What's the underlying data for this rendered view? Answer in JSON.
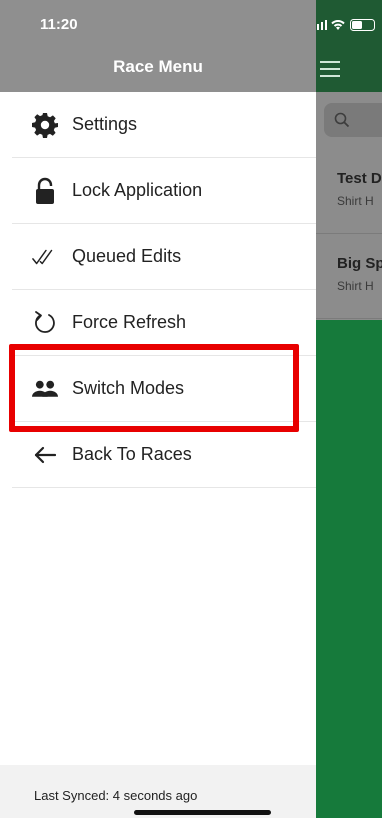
{
  "status": {
    "time": "11:20"
  },
  "drawer": {
    "title": "Race Menu",
    "items": [
      {
        "label": "Settings",
        "icon": "gear-icon"
      },
      {
        "label": "Lock Application",
        "icon": "lock-icon"
      },
      {
        "label": "Queued Edits",
        "icon": "double-check-icon"
      },
      {
        "label": "Force Refresh",
        "icon": "refresh-icon"
      },
      {
        "label": "Switch Modes",
        "icon": "users-icon"
      },
      {
        "label": "Back To Races",
        "icon": "arrow-left-icon"
      }
    ],
    "footer": {
      "last_synced": "Last Synced: 4 seconds ago"
    }
  },
  "background_app": {
    "races": [
      {
        "title": "Test D",
        "subtitle": "Shirt H"
      },
      {
        "title": "Big Sp",
        "subtitle": "Shirt H"
      }
    ]
  },
  "colors": {
    "drawer_header": "#8f8f8f",
    "highlight": "#e80000",
    "app_header": "#1f5a33",
    "app_body": "#167a3b"
  }
}
